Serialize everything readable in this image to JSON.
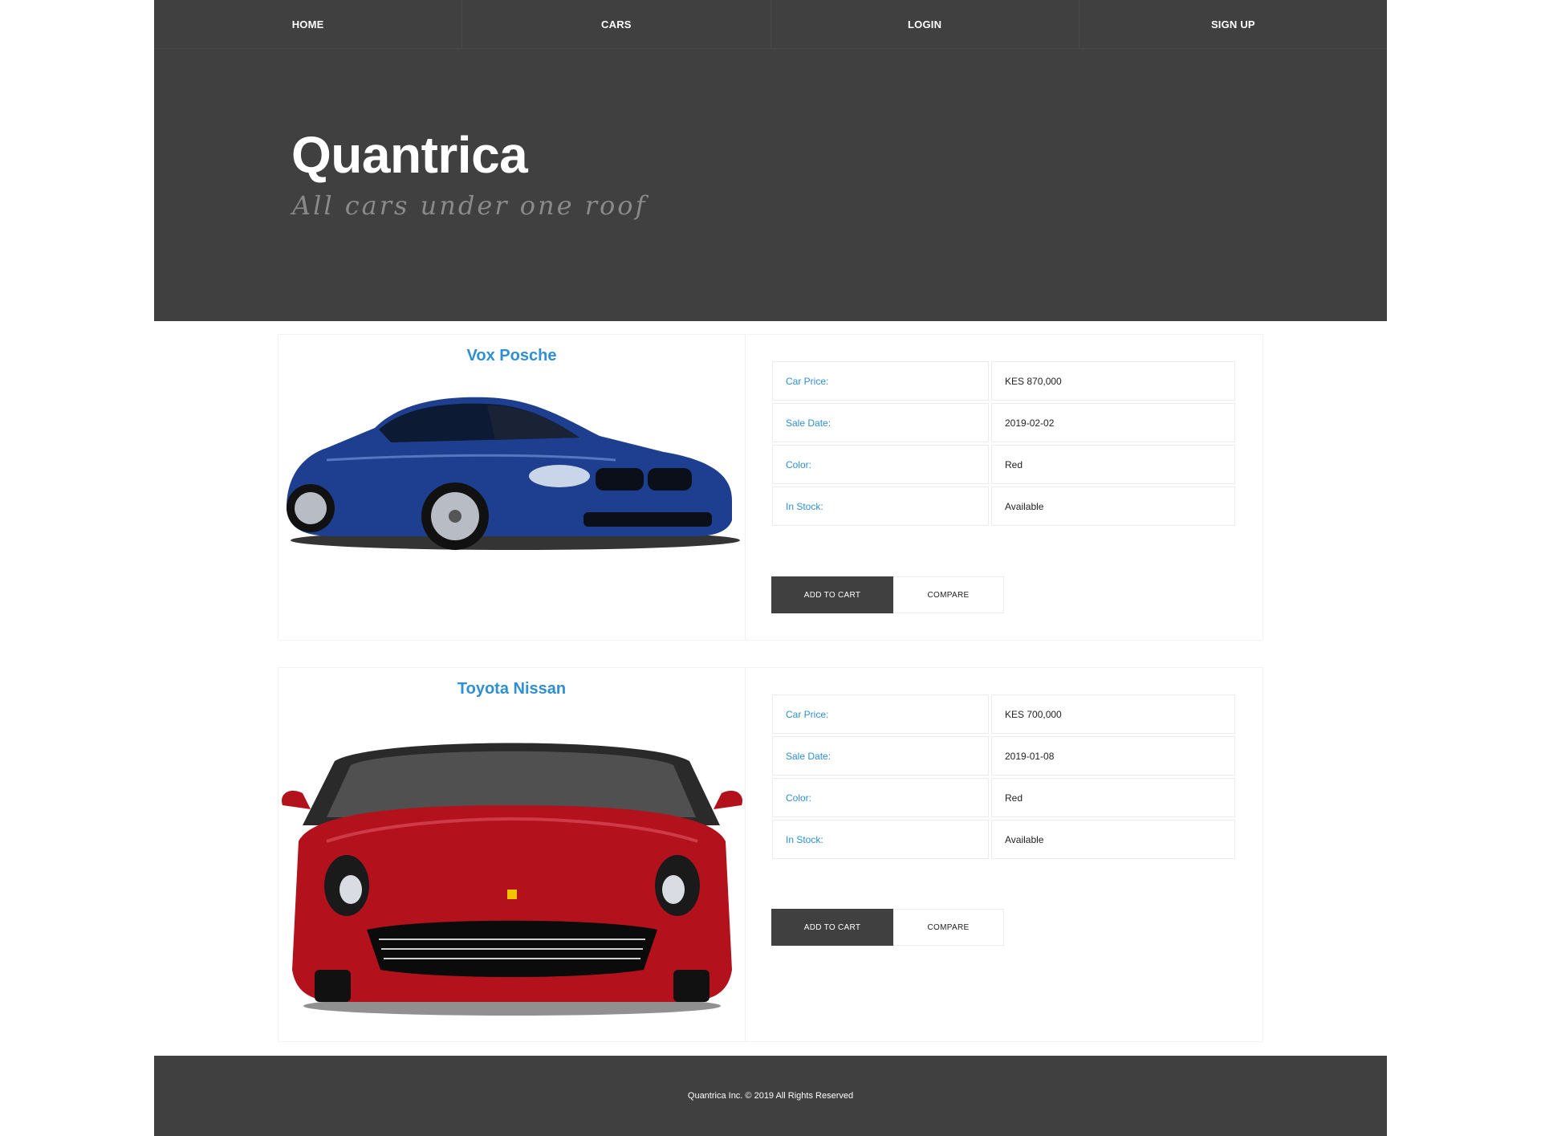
{
  "nav": {
    "items": [
      {
        "label": "HOME"
      },
      {
        "label": "CARS"
      },
      {
        "label": "LOGIN"
      },
      {
        "label": "SIGN UP"
      }
    ]
  },
  "hero": {
    "title": "Quantrica",
    "subtitle": "All cars under one roof"
  },
  "cars": [
    {
      "name": "Vox Posche",
      "image_icon": "blue-coupe-image",
      "specs": [
        {
          "label": "Car Price:",
          "value": "KES 870,000"
        },
        {
          "label": "Sale Date:",
          "value": "2019-02-02"
        },
        {
          "label": "Color:",
          "value": "Red"
        },
        {
          "label": "In Stock:",
          "value": "Available"
        }
      ],
      "add_to_cart_label": "ADD TO CART",
      "compare_label": "COMPARE"
    },
    {
      "name": "Toyota Nissan",
      "image_icon": "red-convertible-image",
      "specs": [
        {
          "label": "Car Price:",
          "value": "KES 700,000"
        },
        {
          "label": "Sale Date:",
          "value": "2019-01-08"
        },
        {
          "label": "Color:",
          "value": "Red"
        },
        {
          "label": "In Stock:",
          "value": "Available"
        }
      ],
      "add_to_cart_label": "ADD TO CART",
      "compare_label": "COMPARE"
    }
  ],
  "footer": {
    "text": "Quantrica Inc. © 2019 All Rights Reserved"
  },
  "colors": {
    "dark_bg": "#404040",
    "accent_blue": "#2f8fd0",
    "car1_body": "#1e3f8f",
    "car2_body": "#b3121d"
  }
}
